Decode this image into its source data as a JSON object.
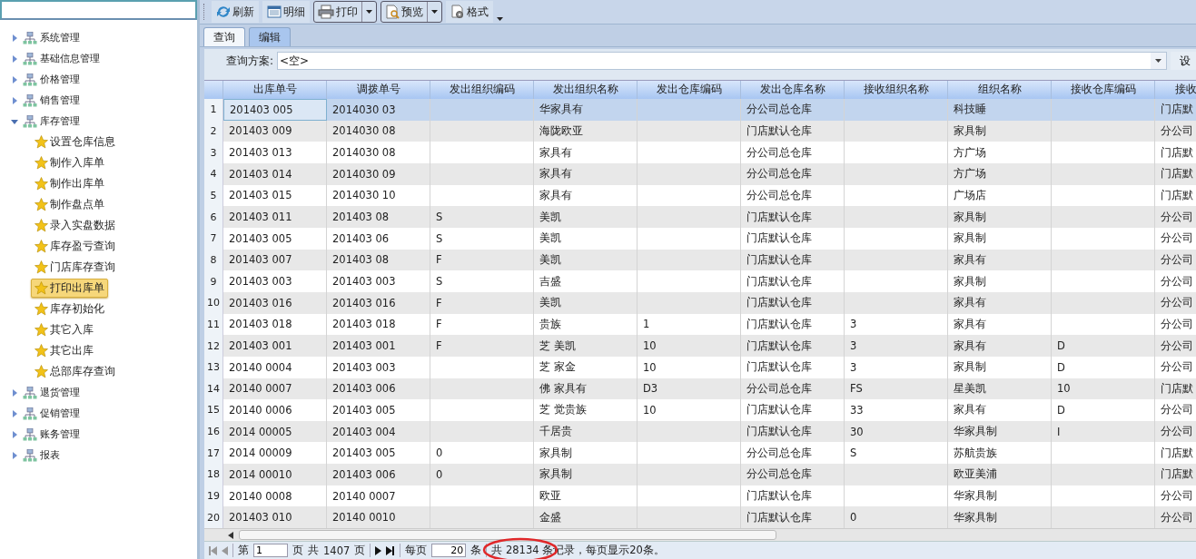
{
  "sidebar": {
    "tree": [
      {
        "label": "系统管理",
        "expanded": false
      },
      {
        "label": "基础信息管理",
        "expanded": false
      },
      {
        "label": "价格管理",
        "expanded": false
      },
      {
        "label": "销售管理",
        "expanded": false
      },
      {
        "label": "库存管理",
        "expanded": true,
        "children": [
          {
            "label": "设置仓库信息",
            "selected": false
          },
          {
            "label": "制作入库单",
            "selected": false
          },
          {
            "label": "制作出库单",
            "selected": false
          },
          {
            "label": "制作盘点单",
            "selected": false
          },
          {
            "label": "录入实盘数据",
            "selected": false
          },
          {
            "label": "库存盈亏查询",
            "selected": false
          },
          {
            "label": "门店库存查询",
            "selected": false
          },
          {
            "label": "打印出库单",
            "selected": true
          },
          {
            "label": "库存初始化",
            "selected": false
          },
          {
            "label": "其它入库",
            "selected": false
          },
          {
            "label": "其它出库",
            "selected": false
          },
          {
            "label": "总部库存查询",
            "selected": false
          }
        ]
      },
      {
        "label": "退货管理",
        "expanded": false
      },
      {
        "label": "促销管理",
        "expanded": false
      },
      {
        "label": "账务管理",
        "expanded": false
      },
      {
        "label": "报表",
        "expanded": false
      }
    ]
  },
  "toolbar": [
    {
      "label": "刷新",
      "kind": "refresh",
      "split": false
    },
    {
      "label": "明细",
      "kind": "detail",
      "split": false
    },
    {
      "label": "打印",
      "kind": "print",
      "split": true
    },
    {
      "label": "预览",
      "kind": "preview",
      "split": true
    },
    {
      "label": "格式",
      "kind": "format",
      "split": false
    }
  ],
  "tabs": [
    {
      "label": "查询",
      "selected": true
    },
    {
      "label": "编辑",
      "selected": false
    }
  ],
  "query": {
    "label": "查询方案:",
    "value": "<空>",
    "side_button": "设"
  },
  "table": {
    "columns": [
      "出库单号",
      "调拨单号",
      "发出组织编码",
      "发出组织名称",
      "发出仓库编码",
      "发出仓库名称",
      "接收组织名称",
      "组织名称",
      "接收仓库编码",
      "接收"
    ],
    "rows": [
      {
        "number": "1",
        "selected": true,
        "cells": [
          "201403 005",
          "2014030 03",
          "",
          "华家具有",
          "",
          "分公司总仓库",
          "",
          "科技睡",
          "",
          "门店默"
        ]
      },
      {
        "number": "2",
        "selected": false,
        "cells": [
          "201403 009",
          "2014030 08",
          "",
          "海陇欧亚",
          "",
          "门店默认仓库",
          "",
          "家具制",
          "",
          "分公司"
        ]
      },
      {
        "number": "3",
        "selected": false,
        "cells": [
          "201403 013",
          "2014030 08",
          "",
          "家具有",
          "",
          "分公司总仓库",
          "",
          "方广场",
          "",
          "门店默"
        ]
      },
      {
        "number": "4",
        "selected": false,
        "cells": [
          "201403 014",
          "2014030 09",
          "",
          "家具有",
          "",
          "分公司总仓库",
          "",
          "方广场",
          "",
          "门店默"
        ]
      },
      {
        "number": "5",
        "selected": false,
        "cells": [
          "201403 015",
          "2014030 10",
          "",
          "家具有",
          "",
          "分公司总仓库",
          "",
          "广场店",
          "",
          "门店默"
        ]
      },
      {
        "number": "6",
        "selected": false,
        "cells": [
          "201403 011",
          "201403 08",
          "S",
          "美凯",
          "",
          "门店默认仓库",
          "",
          "家具制",
          "",
          "分公司"
        ]
      },
      {
        "number": "7",
        "selected": false,
        "cells": [
          "201403 005",
          "201403 06",
          "S",
          "美凯",
          "",
          "门店默认仓库",
          "",
          "家具制",
          "",
          "分公司"
        ]
      },
      {
        "number": "8",
        "selected": false,
        "cells": [
          "201403 007",
          "201403 08",
          "F",
          "美凯",
          "",
          "门店默认仓库",
          "",
          "家具有",
          "",
          "分公司"
        ]
      },
      {
        "number": "9",
        "selected": false,
        "cells": [
          "201403 003",
          "201403 003",
          "S",
          "吉盛",
          "",
          "门店默认仓库",
          "",
          "家具制",
          "",
          "分公司"
        ]
      },
      {
        "number": "10",
        "selected": false,
        "cells": [
          "201403 016",
          "201403 016",
          "F",
          "美凯",
          "",
          "门店默认仓库",
          "",
          "家具有",
          "",
          "分公司"
        ]
      },
      {
        "number": "11",
        "selected": false,
        "cells": [
          "201403 018",
          "201403 018",
          "F",
          "贵族",
          "1",
          "门店默认仓库",
          "3",
          "家具有",
          "",
          "分公司"
        ]
      },
      {
        "number": "12",
        "selected": false,
        "cells": [
          "201403 001",
          "201403 001",
          "F",
          "芝 美凯",
          "10",
          "门店默认仓库",
          "3",
          "家具有",
          "D",
          "分公司"
        ]
      },
      {
        "number": "13",
        "selected": false,
        "cells": [
          "20140 0004",
          "201403 003",
          "",
          "芝 家金",
          "10",
          "门店默认仓库",
          "3",
          "家具制",
          "D",
          "分公司"
        ]
      },
      {
        "number": "14",
        "selected": false,
        "cells": [
          "20140 0007",
          "201403 006",
          "",
          "佛 家具有",
          "D3",
          "分公司总仓库",
          "FS",
          "星美凯",
          "10",
          "门店默"
        ]
      },
      {
        "number": "15",
        "selected": false,
        "cells": [
          "20140 0006",
          "201403 005",
          "",
          "芝 觉贵族",
          "10",
          "门店默认仓库",
          "33",
          "家具有",
          "D",
          "分公司"
        ]
      },
      {
        "number": "16",
        "selected": false,
        "cells": [
          "2014 00005",
          "201403 004",
          "",
          "千居贵",
          "",
          "门店默认仓库",
          "30",
          "华家具制",
          "I",
          "分公司"
        ]
      },
      {
        "number": "17",
        "selected": false,
        "cells": [
          "2014 00009",
          "201403 005",
          "0",
          "家具制",
          "",
          "分公司总仓库",
          "S",
          "苏航贵族",
          "",
          "门店默"
        ]
      },
      {
        "number": "18",
        "selected": false,
        "cells": [
          "2014 00010",
          "201403 006",
          "0",
          "家具制",
          "",
          "分公司总仓库",
          "",
          "欧亚美浦",
          "",
          "门店默"
        ]
      },
      {
        "number": "19",
        "selected": false,
        "cells": [
          "20140 0008",
          "20140 0007",
          "",
          "欧亚",
          "",
          "门店默认仓库",
          "",
          "华家具制",
          "",
          "分公司"
        ]
      },
      {
        "number": "20",
        "selected": false,
        "cells": [
          "201403 010",
          "20140 0010",
          "",
          "金盛",
          "",
          "门店默认仓库",
          "0",
          "华家具制",
          "",
          "分公司"
        ]
      }
    ]
  },
  "pager": {
    "page_label": "第",
    "page": "1",
    "page_unit": "页",
    "total_label": "共",
    "total_pages": "1407",
    "total_unit": "页",
    "per_page_label": "每页",
    "per_page": "20",
    "per_page_unit": "条",
    "summary": "共 28134 条记录，每页显示20条。",
    "summary_circled": true
  }
}
